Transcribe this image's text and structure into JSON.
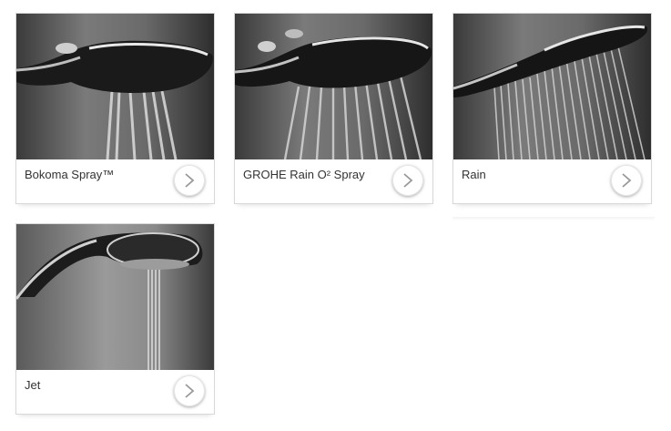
{
  "products": [
    {
      "label": "Bokoma Spray™",
      "image_icon": "shower-head-spray-icon",
      "arrow_icon": "chevron-right-icon"
    },
    {
      "label": "GROHE Rain O² Spray",
      "image_icon": "shower-head-rain-o2-icon",
      "arrow_icon": "chevron-right-icon"
    },
    {
      "label": "Rain",
      "image_icon": "shower-head-rain-icon",
      "arrow_icon": "chevron-right-icon"
    },
    {
      "label": "Jet",
      "image_icon": "shower-head-jet-icon",
      "arrow_icon": "chevron-right-icon"
    }
  ],
  "colors": {
    "border": "#d8d8d8",
    "text": "#333333",
    "arrow": "#999999"
  }
}
